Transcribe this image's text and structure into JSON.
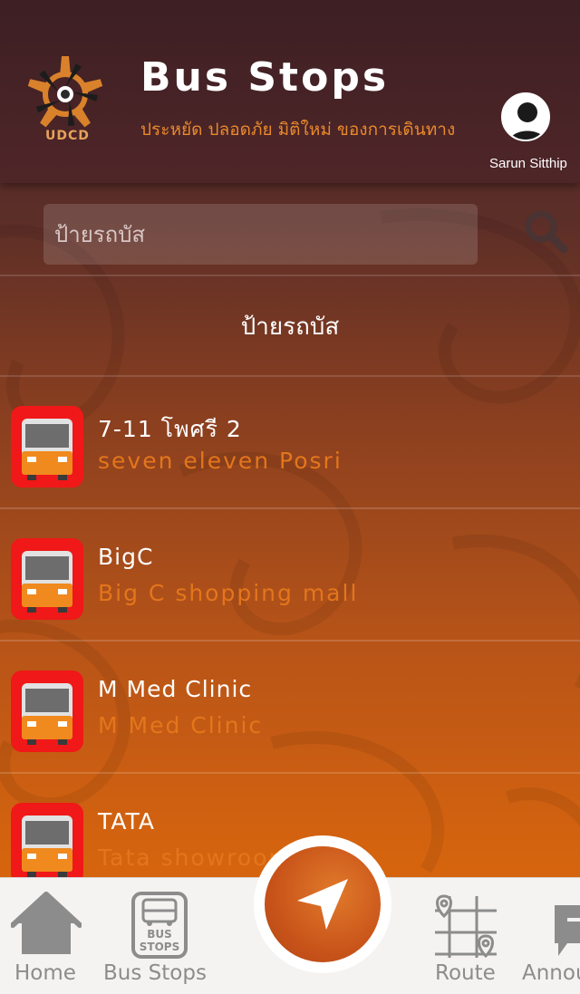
{
  "header": {
    "logo_text": "UDCD",
    "title": "Bus Stops",
    "subtitle": "ประหยัด ปลอดภัย มิติใหม่ ของการเดินทาง",
    "user_name": "Sarun Sitthip"
  },
  "search": {
    "placeholder": "ป้ายรถบัส"
  },
  "section_title": "ป้ายรถบัส",
  "stops": [
    {
      "name": "7-11 โพศรี 2",
      "description": "seven eleven Posri"
    },
    {
      "name": "BigC",
      "description": "Big C shopping mall"
    },
    {
      "name": "M Med Clinic",
      "description": "M Med Clinic"
    },
    {
      "name": "TATA",
      "description": "Tata showroom"
    }
  ],
  "tabbar": {
    "home_label": "Home",
    "bus_stops_label": "Bus Stops",
    "bus_stops_icon_text_1": "BUS",
    "bus_stops_icon_text_2": "STOPS",
    "route_label": "Route",
    "announce_label": "Announce"
  },
  "colors": {
    "accent": "#e9892c",
    "bus_icon_bg": "#f01818",
    "tab_inactive": "#8c8c8c"
  },
  "icons": [
    "udcd-logo",
    "user-avatar-icon",
    "search-icon",
    "bus-icon",
    "home-icon",
    "bus-stops-icon",
    "navigation-arrow-icon",
    "route-map-icon",
    "announce-icon"
  ]
}
